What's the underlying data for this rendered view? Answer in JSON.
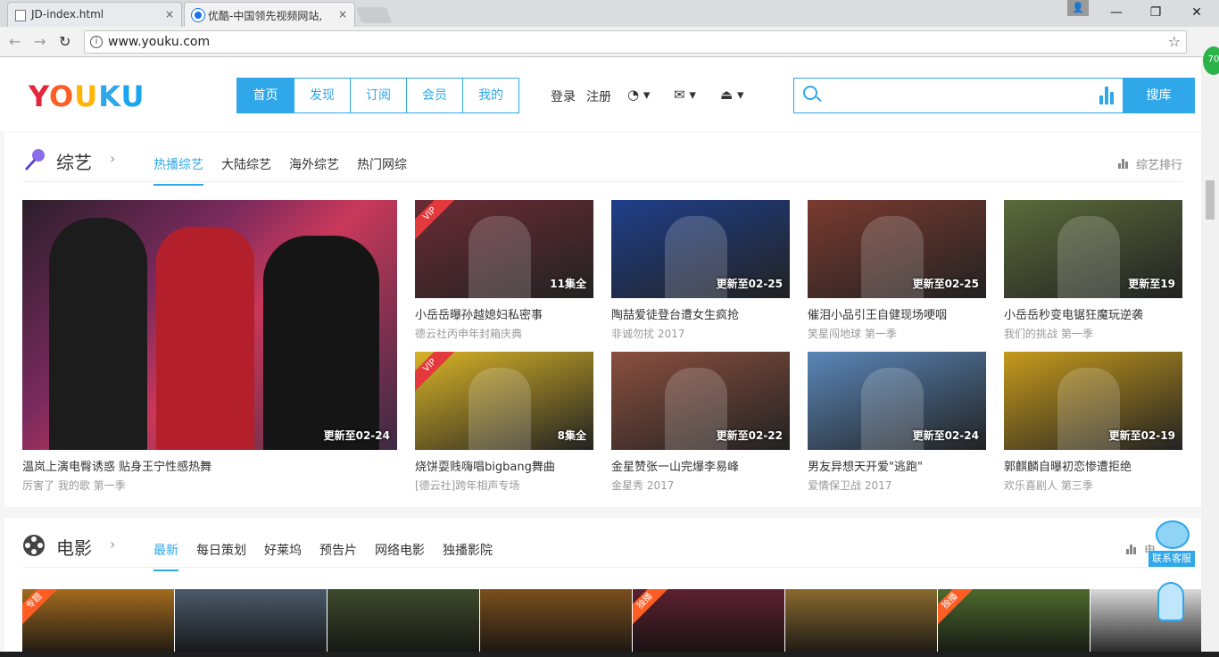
{
  "browser": {
    "tabs": [
      {
        "title": "JD-index.html",
        "close": "×"
      },
      {
        "title": "优酷-中国领先视频网站,",
        "close": "×"
      }
    ],
    "address": "www.youku.com",
    "window_controls": {
      "minimize": "—",
      "maximize": "❐",
      "close": "✕"
    }
  },
  "header": {
    "logo": [
      "Y",
      "O",
      "U",
      "K",
      "U"
    ],
    "nav_tabs": [
      "首页",
      "发现",
      "订阅",
      "会员",
      "我的"
    ],
    "login": "登录",
    "register": "注册",
    "search_button": "搜库",
    "search_placeholder": ""
  },
  "variety": {
    "title": "综艺",
    "tabs": [
      "热播综艺",
      "大陆综艺",
      "海外综艺",
      "热门网综"
    ],
    "rank_link": "综艺排行",
    "featured": {
      "badge": "更新至02-24",
      "title": "温岚上演电臀诱惑 贴身王宁性感热舞",
      "subtitle": "厉害了 我的歌 第一季"
    },
    "cards": [
      {
        "badge": "11集全",
        "vip": "VIP",
        "title": "小岳岳曝孙越媳妇私密事",
        "subtitle": "德云社丙申年封箱庆典",
        "color": "#6b2b34"
      },
      {
        "badge": "更新至02-25",
        "vip": "",
        "title": "陶喆爱徒登台遭女生疯抢",
        "subtitle": "非诚勿扰 2017",
        "color": "#1f3f8a"
      },
      {
        "badge": "更新至02-25",
        "vip": "",
        "title": "催泪小品引王自健现场哽咽",
        "subtitle": "笑星闯地球 第一季",
        "color": "#7a3a30"
      },
      {
        "badge": "更新至19",
        "vip": "",
        "title": "小岳岳秒变电锯狂魔玩逆袭",
        "subtitle": "我们的挑战 第一季",
        "color": "#5b6b3a"
      },
      {
        "badge": "8集全",
        "vip": "VIP",
        "title": "烧饼耍贱嗨唱bigbang舞曲",
        "subtitle": "[德云社]跨年相声专场",
        "color": "#d8b327"
      },
      {
        "badge": "更新至02-22",
        "vip": "",
        "title": "金星赞张一山完爆李易峰",
        "subtitle": "金星秀 2017",
        "color": "#8a4f3f"
      },
      {
        "badge": "更新至02-24",
        "vip": "",
        "title": "男友异想天开爱\"逃跑\"",
        "subtitle": "爱情保卫战 2017",
        "color": "#5a86b8"
      },
      {
        "badge": "更新至02-19",
        "vip": "",
        "title": "郭麒麟自曝初恋惨遭拒绝",
        "subtitle": "欢乐喜剧人 第三季",
        "color": "#c69a1c"
      }
    ]
  },
  "movies": {
    "title": "电影",
    "tabs": [
      "最新",
      "每日策划",
      "好莱坞",
      "预告片",
      "网络电影",
      "独播影院"
    ],
    "rank_link": "电",
    "posters": [
      {
        "tag": "专题",
        "color": "#a36b1e"
      },
      {
        "tag": "",
        "color": "#4b5a6a"
      },
      {
        "tag": "",
        "color": "#3e4a2c"
      },
      {
        "tag": "",
        "color": "#7a4f1c"
      },
      {
        "tag": "独播",
        "color": "#5d2130"
      },
      {
        "tag": "",
        "color": "#8a6a2f"
      },
      {
        "tag": "独播",
        "color": "#4d6a2d"
      },
      {
        "tag": "",
        "color": "#d9d9d9"
      }
    ]
  },
  "widgets": {
    "service": "联系客服",
    "score": "70"
  }
}
